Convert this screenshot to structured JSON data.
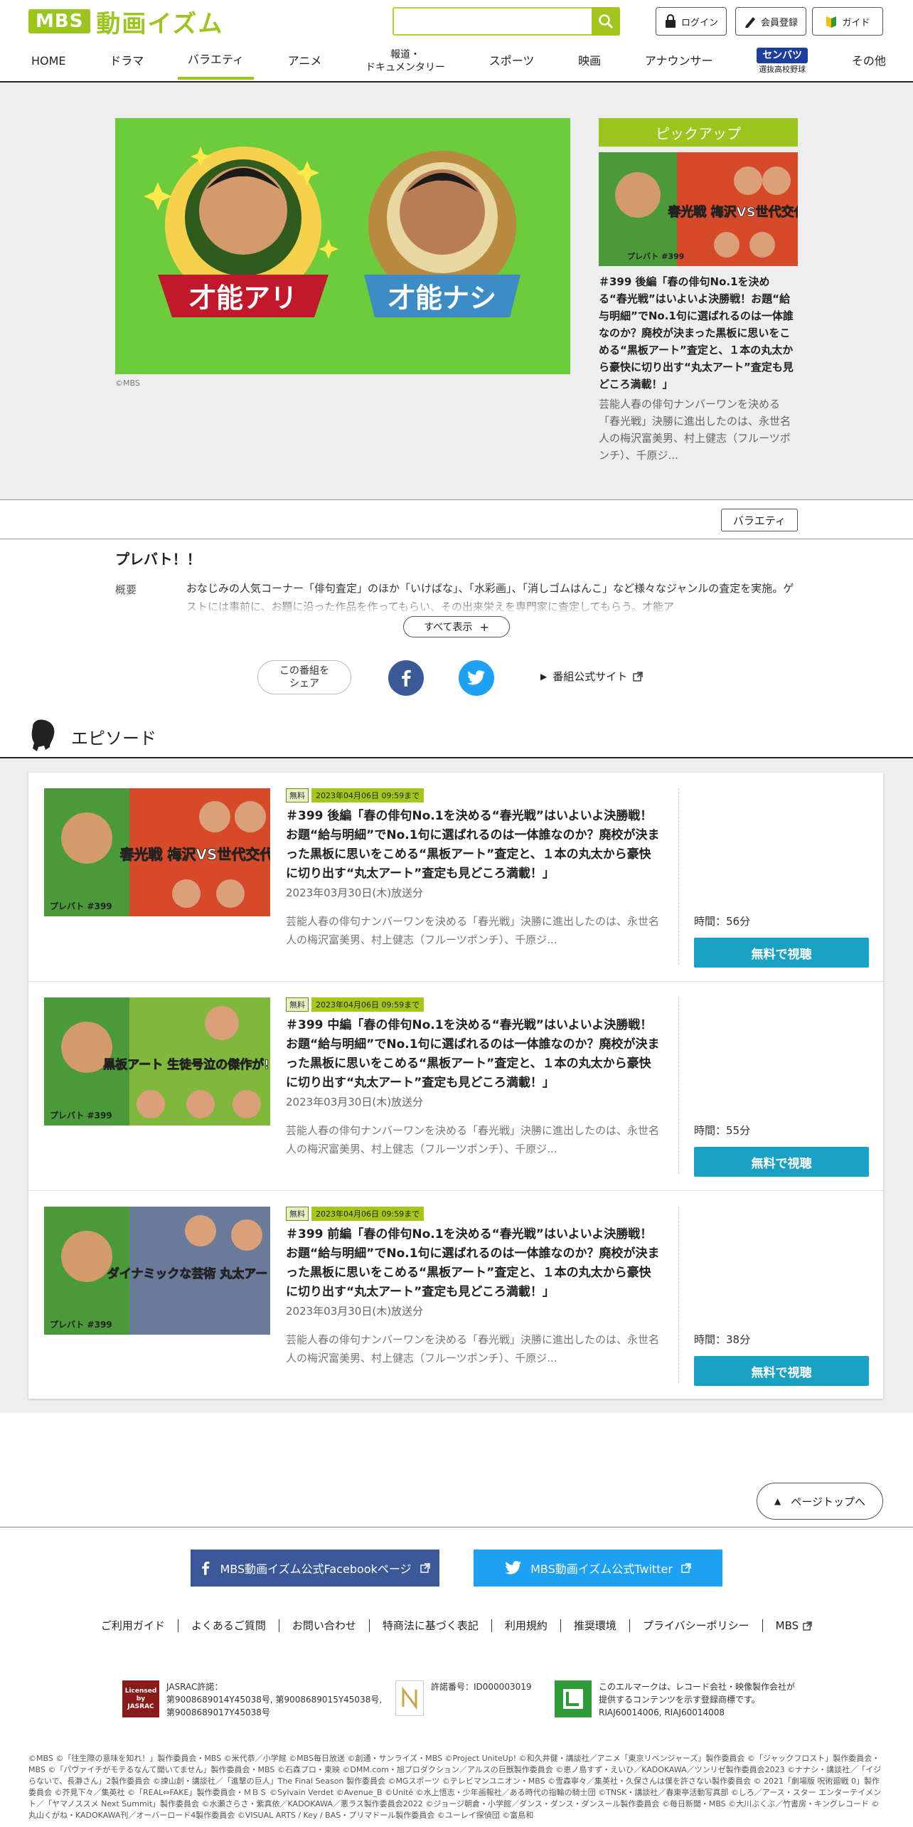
{
  "brand": {
    "logo_mbs": "MBS",
    "logo_text": "動画イズム"
  },
  "header": {
    "search_placeholder": "",
    "login": "ログイン",
    "register": "会員登録",
    "guide": "ガイド"
  },
  "nav": {
    "items": [
      "HOME",
      "ドラマ",
      "バラエティ",
      "アニメ",
      "報道・\nドキュメンタリー",
      "スポーツ",
      "映画",
      "アナウンサー",
      "その他"
    ],
    "senbatsu_logo": "センバツ",
    "senbatsu_sub": "選抜高校野球",
    "active": "バラエティ"
  },
  "hero": {
    "left_label": "才能アリ",
    "right_label": "才能ナシ",
    "copyright": "©MBS"
  },
  "pickup": {
    "label": "ピックアップ",
    "thumb_text": "春光戦 梅沢VS世代交代",
    "title": "＃399 後編「春の俳句No.1を決める“春光戦”はいよいよ決勝戦！お題“給与明細”でNo.1句に選ばれるのは一体誰なのか？廃校が決まった黒板に思いをこめる“黒板アート”査定と、１本の丸太から豪快に切り出す“丸太アート”査定も見どころ満載！」",
    "desc": "芸能人春の俳句ナンバーワンを決める「春光戦」決勝に進出したのは、永世名人の梅沢富美男、村上健志（フルーツポンチ）、千原ジ..."
  },
  "category_tag": "バラエティ",
  "program": {
    "title": "プレバト！！",
    "overview_label": "概要",
    "overview_text": "おなじみの人気コーナー「俳句査定」のほか「いけばな」、「水彩画」、「消しゴムはんこ」など様々なジャンルの査定を実施。ゲストには事前に、お題に沿った作品を作ってもらい、その出来栄えを専門家に査定してもらう。才能ア",
    "show_all": "すべて表示"
  },
  "share": {
    "label": "この番組を\nシェア",
    "official_site": "番組公式サイト"
  },
  "episodes_header": "エピソード",
  "episodes": [
    {
      "badge_free": "無料",
      "badge_until": "2023年04月06日 09:59まで",
      "thumb_text": "春光戦 梅沢VS世代交代",
      "title": "＃399 後編「春の俳句No.1を決める“春光戦”はいよいよ決勝戦！お題“給与明細”でNo.1句に選ばれるのは一体誰なのか？廃校が決まった黒板に思いをこめる“黒板アート”査定と、１本の丸太から豪快に切り出す“丸太アート”査定も見どころ満載！」",
      "date": "2023年03月30日(木)放送分",
      "desc": "芸能人春の俳句ナンバーワンを決める「春光戦」決勝に進出したのは、永世名人の梅沢富美男、村上健志（フルーツポンチ）、千原ジ...",
      "time": "時間：56分",
      "watch": "無料で視聴"
    },
    {
      "badge_free": "無料",
      "badge_until": "2023年04月06日 09:59まで",
      "thumb_text": "黒板アート 生徒号泣の傑作が!",
      "title": "＃399 中編「春の俳句No.1を決める“春光戦”はいよいよ決勝戦！お題“給与明細”でNo.1句に選ばれるのは一体誰なのか？廃校が決まった黒板に思いをこめる“黒板アート”査定と、１本の丸太から豪快に切り出す“丸太アート”査定も見どころ満載！」",
      "date": "2023年03月30日(木)放送分",
      "desc": "芸能人春の俳句ナンバーワンを決める「春光戦」決勝に進出したのは、永世名人の梅沢富美男、村上健志（フルーツポンチ）、千原ジ...",
      "time": "時間：55分",
      "watch": "無料で視聴"
    },
    {
      "badge_free": "無料",
      "badge_until": "2023年04月06日 09:59まで",
      "thumb_text": "ダイナミックな芸術 丸太アート",
      "title": "＃399 前編「春の俳句No.1を決める“春光戦”はいよいよ決勝戦！お題“給与明細”でNo.1句に選ばれるのは一体誰なのか？廃校が決まった黒板に思いをこめる“黒板アート”査定と、１本の丸太から豪快に切り出す“丸太アート”査定も見どころ満載！」",
      "date": "2023年03月30日(木)放送分",
      "desc": "芸能人春の俳句ナンバーワンを決める「春光戦」決勝に進出したのは、永世名人の梅沢富美男、村上健志（フルーツポンチ）、千原ジ...",
      "time": "時間：38分",
      "watch": "無料で視聴"
    }
  ],
  "thumb_tag": "プレバト #399",
  "pagetop": "ページトップへ",
  "footer": {
    "facebook": "MBS動画イズム公式Facebookページ",
    "twitter": "MBS動画イズム公式Twitter",
    "links": [
      "ご利用ガイド",
      "よくあるご質問",
      "お問い合わせ",
      "特商法に基づく表記",
      "利用規約",
      "推奨環境",
      "プライバシーポリシー",
      "MBS"
    ],
    "jasrac_logo": "Licensed by JASRAC",
    "jasrac_text": "JASRAC許諾：\n第9008689014Y45038号, 第9008689015Y45038号,\n第9008689017Y45038号",
    "nextone_text": "許諾番号：ID000003019",
    "lmark_text": "このエルマークは、レコード会社・映像製作会社が\n提供するコンテンツを示す登録商標です。\nRIAJ60014006, RIAJ60014008",
    "copyright": "©MBS ©「往生際の意味を知れ！」製作委員会・MBS ©米代恭／小学館 ©MBS毎日放送 ©創通・サンライズ・MBS ©Project UniteUp! ©和久井健・講談社／アニメ「東京リベンジャーズ」製作委員会 ©「ジャックフロスト」製作委員会・MBS ©「パヴァイチがモテるなんて聞いてません」製作委員会・MBS ©石森プロ・東映 ©DMM.com・旭プロダクション／アルスの巨獣製作委員会 ©恵ノ島すず・えいひ／KADOKAWA／ツンリゼ製作委員会2023 ©ナナシ・講談社／「イジらないで、長瀞さん」2製作委員会 ©諫山創・講談社／「進撃の巨人」The Final Season 製作委員会 ©MGスポーツ ©テレビマンユニオン・MBS ©雪森寧々／集英社・久保さんは僕を許さない製作委員会 © 2021「劇場版 呪術廻戦 0」製作委員会 ©芥見下々／集英社 ©「REAL⇔FAKE」製作委員会・ＭＢＳ ©Sylvain Verdet ©Avenue_B ©Unité ©水上悟志・少年画報社／ある時代の指輪の騎士団 ©TNSK・講談社／春東亭活動写真部 ©しろ／アース・スター エンターテイメント／「ヤマノススメ Next Summit」製作委員会 ©水瀬さらさ・紫真依／KADOKAWA／悪ラス製作委員会2022 ©ジョージ朝倉・小学館／ダンス・ダンス・ダンスール製作委員会 ©毎日新聞・MBS ©大川ぶくぶ／竹書房・キングレコード ©丸山くがね・KADOKAWA刊／オーバーロード4製作委員会 ©VISUAL ARTS / Key / BAS・プリマドール製作委員会 ©ユーレイ探偵団 ©富島和"
  },
  "colors": {
    "brand_green": "#9cc61e",
    "watch_blue": "#1aa0c2",
    "facebook": "#3b5998",
    "twitter": "#1da1f2"
  }
}
